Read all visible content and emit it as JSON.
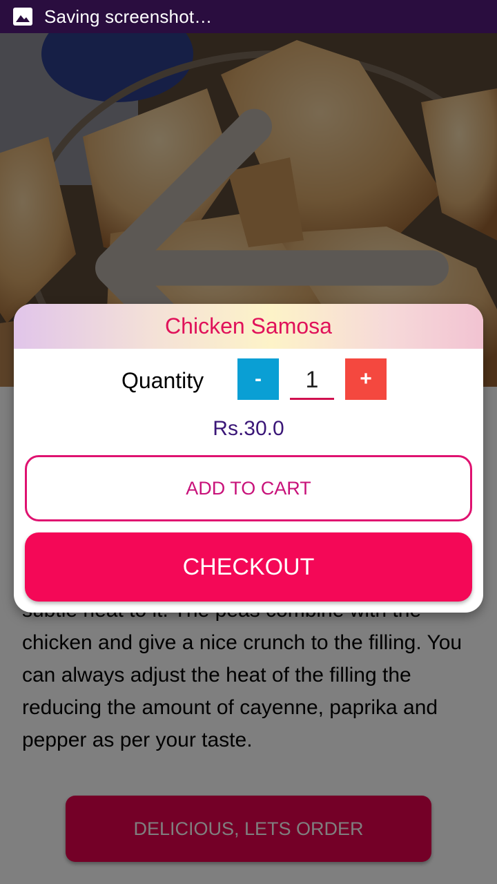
{
  "status_bar": {
    "text": "Saving screenshot…",
    "icon": "image-icon"
  },
  "hero": {
    "back_icon": "arrow-back-icon"
  },
  "description": {
    "text": "subtle heat to it. The peas combine with the chicken and give a nice crunch to the filling. You can always adjust the heat of the filling the reducing the amount of cayenne, paprika and pepper as per your taste."
  },
  "order_button": {
    "label": "DELICIOUS, LETS ORDER"
  },
  "dialog": {
    "title": "Chicken Samosa",
    "quantity_label": "Quantity",
    "minus_label": "-",
    "plus_label": "+",
    "quantity_value": "1",
    "price": "Rs.30.0",
    "add_to_cart_label": "ADD TO CART",
    "checkout_label": "CHECKOUT"
  },
  "colors": {
    "status_bar": "#2a0d3f",
    "accent_pink": "#f40857",
    "title_pink": "#e0125a",
    "minus_blue": "#0a9fd4",
    "plus_red": "#f4483f",
    "price_purple": "#3a1677"
  }
}
